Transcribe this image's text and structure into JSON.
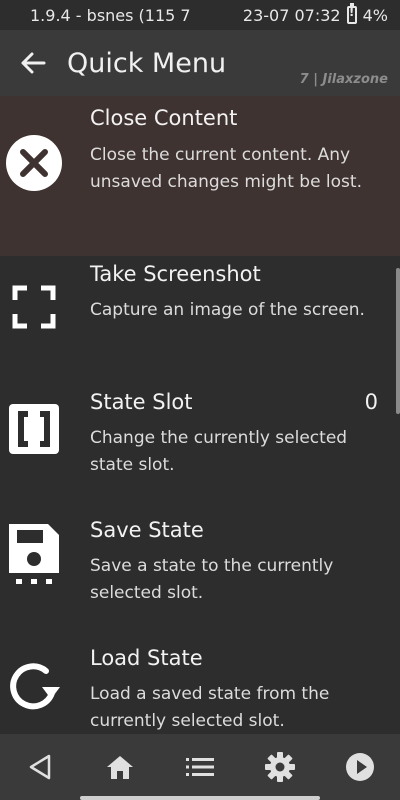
{
  "status_bar": {
    "left_text": "1.9.4 - bsnes (115 7",
    "time": "23-07 07:32",
    "battery": "4%"
  },
  "header": {
    "title": "Quick Menu",
    "watermark": "7 | Jilaxzone"
  },
  "menu": {
    "items": [
      {
        "title": "Close Content",
        "description": "Close the current content. Any unsaved changes might be lost.",
        "icon": "close-circle-icon"
      },
      {
        "title": "Take Screenshot",
        "description": "Capture an image of the screen.",
        "icon": "screenshot-frame-icon"
      },
      {
        "title": "State Slot",
        "value": "0",
        "description": "Change the currently selected state slot.",
        "icon": "state-slot-icon"
      },
      {
        "title": "Save State",
        "description": "Save a state to the currently selected slot.",
        "icon": "save-floppy-icon"
      },
      {
        "title": "Load State",
        "description": "Load a saved state from the currently selected slot.",
        "icon": "load-reload-icon"
      }
    ]
  },
  "bottom_bar": {
    "icons": [
      "back-triangle-icon",
      "home-icon",
      "list-icon",
      "gear-icon",
      "play-icon"
    ]
  },
  "colors": {
    "background": "#2d2d2d",
    "header": "#3a3a3a",
    "selected_row": "#3f3331",
    "text": "#f2f2f2"
  }
}
